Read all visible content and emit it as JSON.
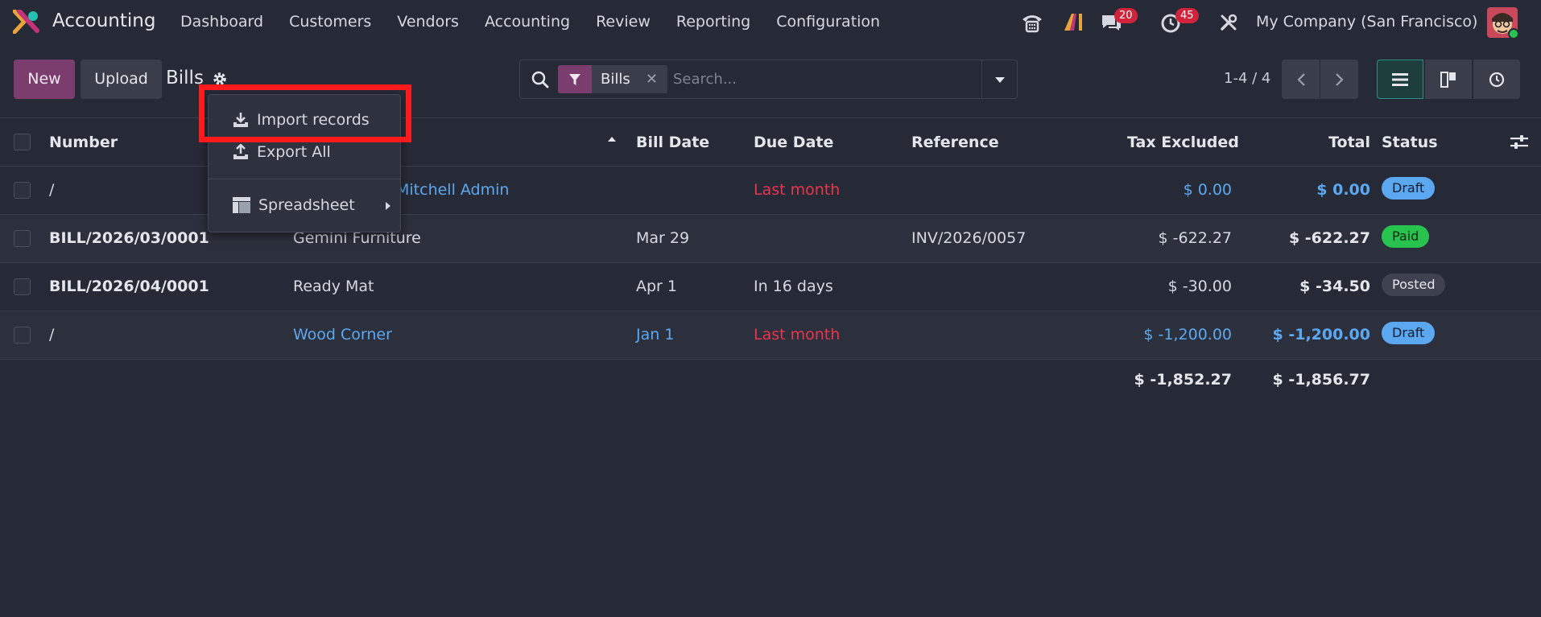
{
  "app": {
    "name": "Accounting"
  },
  "nav": {
    "items": [
      "Dashboard",
      "Customers",
      "Vendors",
      "Accounting",
      "Review",
      "Reporting",
      "Configuration"
    ],
    "messages_count": "20",
    "activities_count": "45",
    "company": "My Company (San Francisco)"
  },
  "control": {
    "new_label": "New",
    "upload_label": "Upload",
    "title": "Bills",
    "facet_value": "Bills",
    "search_placeholder": "Search...",
    "pager": "1-4 / 4"
  },
  "dropdown": {
    "import": "Import records",
    "export": "Export All",
    "spreadsheet": "Spreadsheet"
  },
  "table": {
    "headers": [
      "Number",
      "Bill Date",
      "Due Date",
      "Reference",
      "Tax Excluded",
      "Total",
      "Status"
    ],
    "rows": [
      {
        "number": "/",
        "partner": "Mitchell Admin",
        "bill_date": "",
        "due_date": "Last month",
        "reference": "",
        "tax_excluded": "$ 0.00",
        "total": "$ 0.00",
        "status": "Draft"
      },
      {
        "number": "BILL/2026/03/0001",
        "partner": "Gemini Furniture",
        "bill_date": "Mar 29",
        "due_date": "",
        "reference": "INV/2026/0057",
        "tax_excluded": "$ -622.27",
        "total": "$ -622.27",
        "status": "Paid"
      },
      {
        "number": "BILL/2026/04/0001",
        "partner": "Ready Mat",
        "bill_date": "Apr 1",
        "due_date": "In 16 days",
        "reference": "",
        "tax_excluded": "$ -30.00",
        "total": "$ -34.50",
        "status": "Posted"
      },
      {
        "number": "/",
        "partner": "Wood Corner",
        "bill_date": "Jan 1",
        "due_date": "Last month",
        "reference": "",
        "tax_excluded": "$ -1,200.00",
        "total": "$ -1,200.00",
        "status": "Draft"
      }
    ],
    "totals": {
      "tax_excluded": "$ -1,852.27",
      "total": "$ -1,856.77"
    }
  },
  "colors": {
    "accent": "#7B3C6E",
    "link_blue": "#5CA8F0",
    "danger_red": "#E8354E",
    "draft_badge": "#5CA8F0",
    "paid_badge": "#28C34E",
    "posted_badge": "#3E4250",
    "highlight": "#FF1B1B"
  }
}
